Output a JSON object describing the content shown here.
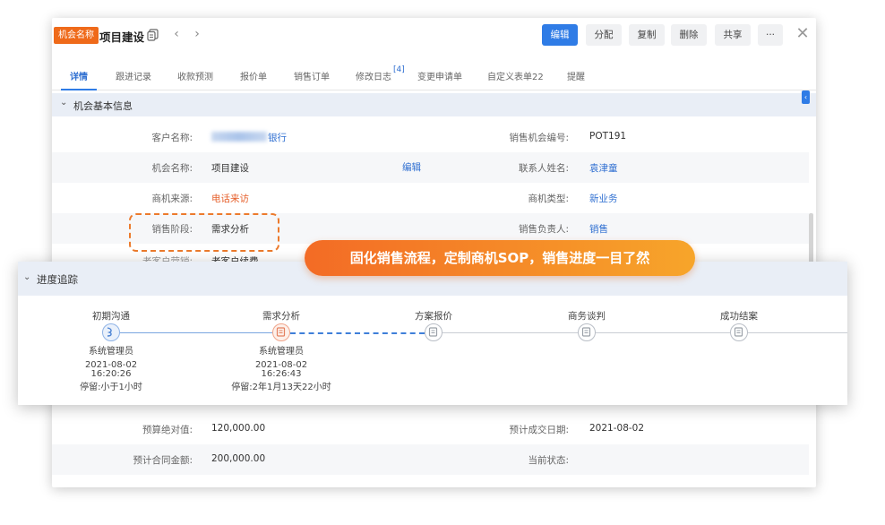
{
  "header": {
    "badge": "机会名称",
    "title": "项目建设",
    "buttons": {
      "edit": "编辑",
      "assign": "分配",
      "copy": "复制",
      "delete": "删除",
      "share": "共享",
      "more": "···"
    }
  },
  "tabs": [
    {
      "label": "详情"
    },
    {
      "label": "跟进记录"
    },
    {
      "label": "收款预测"
    },
    {
      "label": "报价单"
    },
    {
      "label": "销售订单"
    },
    {
      "label": "修改日志"
    },
    {
      "label": "变更申请单"
    },
    {
      "label": "自定义表单22"
    },
    {
      "label": "提醒"
    }
  ],
  "tab_badge": "[4]",
  "basic_section": {
    "title": "机会基本信息"
  },
  "fields": {
    "customer_label": "客户名称:",
    "customer_value_suffix": "银行",
    "opp_no_label": "销售机会编号:",
    "opp_no_value": "POT191",
    "opp_name_label": "机会名称:",
    "opp_name_value": "项目建设",
    "edit_link": "编辑",
    "contact_label": "联系人姓名:",
    "contact_value": "袁津童",
    "source_label": "商机来源:",
    "source_value": "电话来访",
    "type_label": "商机类型:",
    "type_value": "新业务",
    "stage_label": "销售阶段:",
    "stage_value": "需求分析",
    "owner_label": "销售负责人:",
    "owner_value": "销售",
    "hidden_label": "老客户营销:",
    "hidden_value": "老客户续费",
    "budget_label": "预算绝对值:",
    "budget_value": "120,000.00",
    "close_date_label": "预计成交日期:",
    "close_date_value": "2021-08-02",
    "contract_label": "预计合同金额:",
    "contract_value": "200,000.00",
    "status_label": "当前状态:"
  },
  "banner": "固化销售流程，定制商机SOP，销售进度一目了然",
  "progress": {
    "title": "进度追踪",
    "stages": [
      {
        "name": "初期沟通",
        "user": "系统管理员",
        "date": "2021-08-02",
        "time": "16:20:26",
        "stay": "停留:小于1小时"
      },
      {
        "name": "需求分析",
        "user": "系统管理员",
        "date": "2021-08-02",
        "time": "16:26:43",
        "stay": "停留:2年1月13天22小时"
      },
      {
        "name": "方案报价"
      },
      {
        "name": "商务谈判"
      },
      {
        "name": "成功结案"
      }
    ]
  },
  "colors": {
    "accent": "#2f7ce6",
    "badge": "#ef6a1a",
    "highlight": "#ec7a2c",
    "link": "#2f6fd1"
  }
}
